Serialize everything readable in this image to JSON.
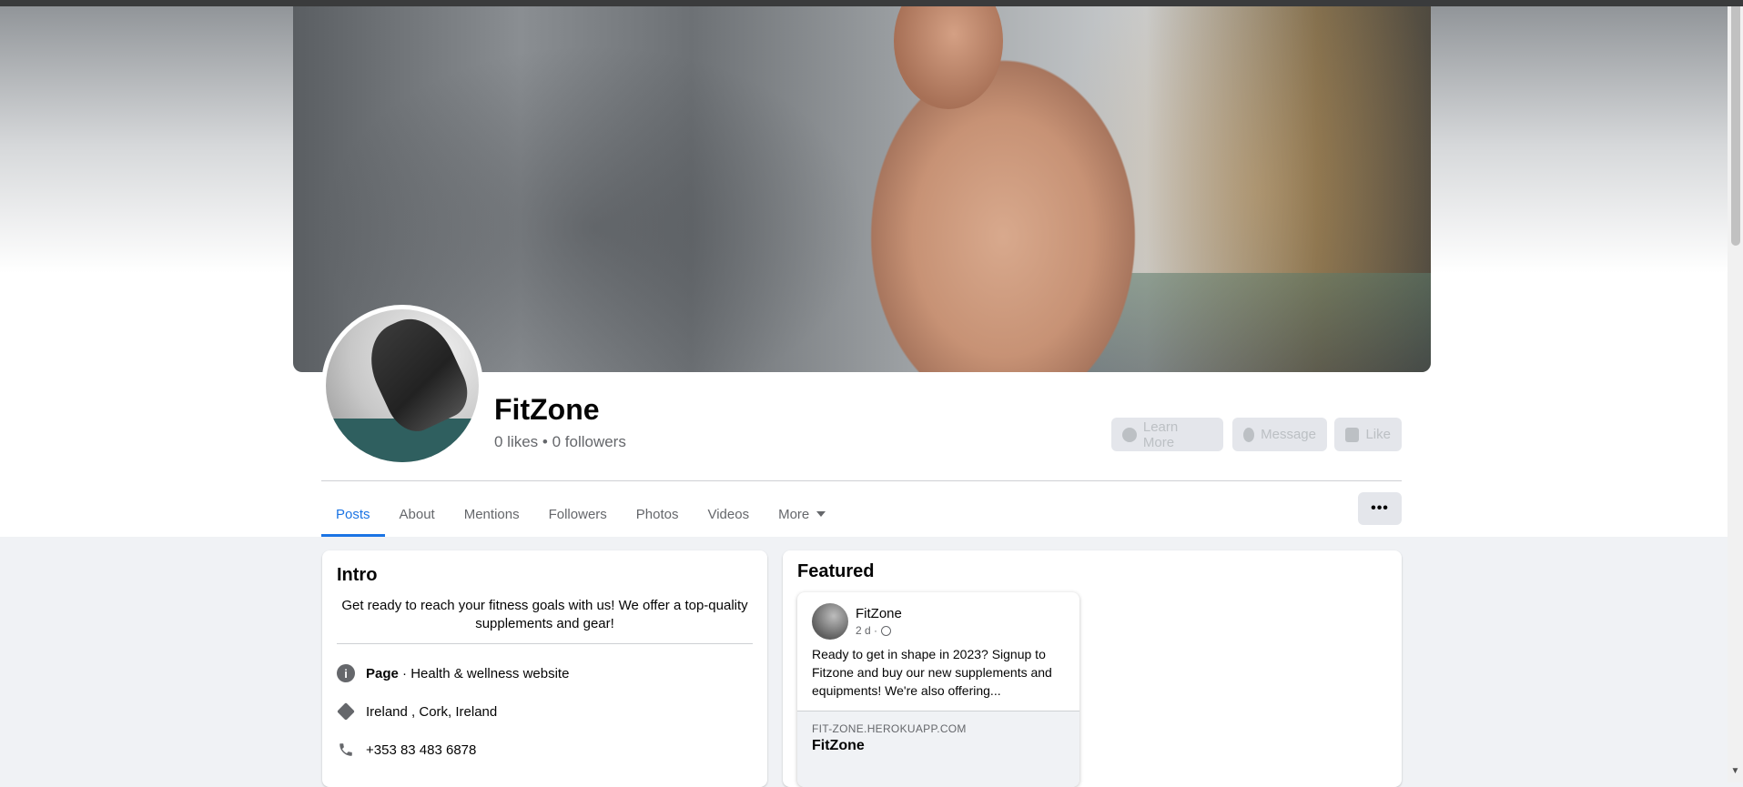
{
  "page": {
    "name": "FitZone",
    "stats": "0 likes • 0 followers"
  },
  "actions": {
    "learn_more": "Learn More",
    "message": "Message",
    "like": "Like"
  },
  "tabs": [
    {
      "label": "Posts",
      "active": true
    },
    {
      "label": "About"
    },
    {
      "label": "Mentions"
    },
    {
      "label": "Followers"
    },
    {
      "label": "Photos"
    },
    {
      "label": "Videos"
    },
    {
      "label": "More"
    }
  ],
  "more_menu_label": "•••",
  "intro": {
    "title": "Intro",
    "bio": "Get ready to reach your fitness goals with us! We offer a top-quality supplements and gear!",
    "category_bold": "Page",
    "category_rest": " · Health & wellness website",
    "location": "Ireland , Cork, Ireland",
    "phone": "+353 83 483 6878"
  },
  "featured": {
    "title": "Featured",
    "post": {
      "author": "FitZone",
      "time": "2 d ·",
      "text": "Ready to get in shape in 2023? Signup to Fitzone and buy our new supplements and equipments! We're also offering...",
      "link_domain": "FIT-ZONE.HEROKUAPP.COM",
      "link_title": "FitZone"
    }
  },
  "colors": {
    "accent": "#1b74e4",
    "secondary_text": "#65676b",
    "background": "#f0f2f5"
  }
}
